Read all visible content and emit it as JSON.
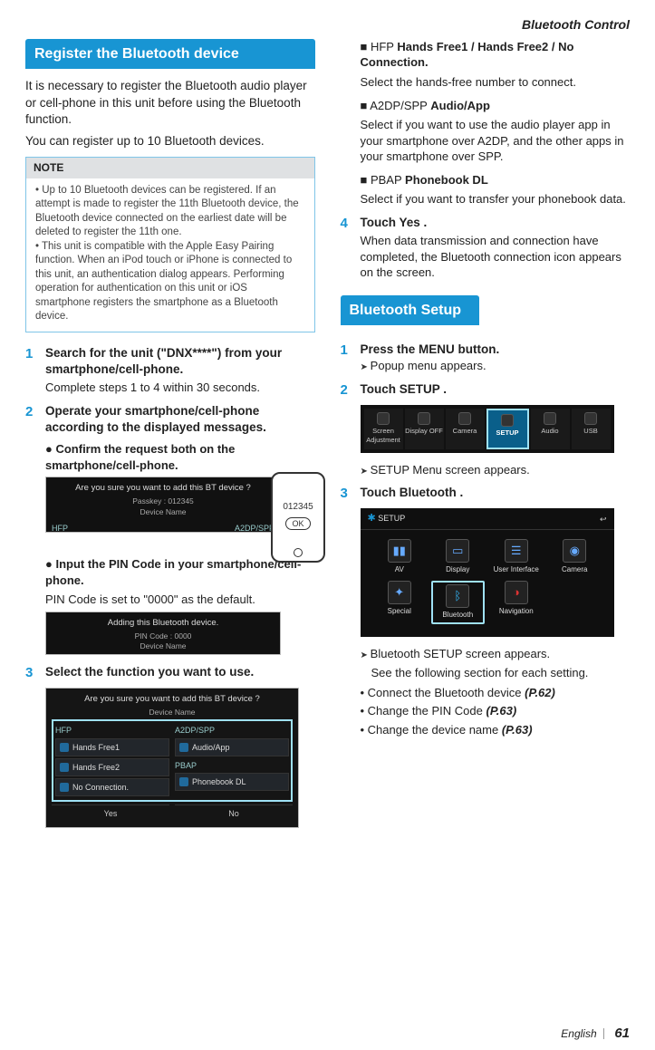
{
  "header": {
    "title": "Bluetooth Control"
  },
  "footer": {
    "lang": "English",
    "page": "61"
  },
  "left": {
    "sectionBar": "Register the Bluetooth device",
    "intro1": "It is necessary to register the Bluetooth audio player or cell-phone in this unit before using the Bluetooth function.",
    "intro2": "You can register up to 10 Bluetooth devices.",
    "noteLabel": "NOTE",
    "note1": "Up to 10 Bluetooth devices can be registered. If an attempt is made to register the 11th Bluetooth device, the Bluetooth device connected on the earliest date will be deleted to register the 11th one.",
    "note2": "This unit is compatible with the Apple Easy Pairing function. When an iPod touch or iPhone is connected to this unit, an authentication dialog appears. Performing operation for authentication on this unit or iOS smartphone registers the smartphone as a Bluetooth device.",
    "step1Title": "Search for the unit (\"DNX****\") from your smartphone/cell-phone.",
    "step1Desc": "Complete steps 1 to 4 within 30 seconds.",
    "step2Title": "Operate your smartphone/cell-phone according to the displayed messages.",
    "step2aTitle": "Confirm the request both on the smartphone/cell-phone.",
    "img1": {
      "line1": "Are you sure you want to add this BT device ?",
      "line2": "Passkey : 012345",
      "line3": "Device Name",
      "hfp": "HFP",
      "a2dp": "A2DP/SPP",
      "phoneCode": "012345",
      "phoneOk": "OK"
    },
    "step2bTitle": "Input the PIN Code in your smartphone/cell-phone.",
    "step2bDesc": "PIN Code is set to \"0000\" as the default.",
    "img2": {
      "line1": "Adding this Bluetooth device.",
      "line2": "PIN Code : 0000",
      "line3": "Device Name"
    },
    "step3Title": "Select the function you want to use.",
    "func": {
      "top": "Are you sure you want to add this BT device ?",
      "sub": "Device Name",
      "hfp": "HFP",
      "a2dp": "A2DP/SPP",
      "pbap": "PBAP",
      "hf1": "Hands Free1",
      "hf2": "Hands Free2",
      "noconn": "No Connection.",
      "audioapp": "Audio/App",
      "phonebook": "Phonebook DL",
      "yes": "Yes",
      "no": "No"
    }
  },
  "right": {
    "hfpLabel": "HFP",
    "hfpOpts": "Hands Free1 /  Hands Free2 /  No Connection.",
    "hfpDesc": "Select the hands-free number to connect.",
    "a2dpLabel": "A2DP/SPP",
    "a2dpOpt": "Audio/App",
    "a2dpDesc": "Select if you want to use the audio player app in your smartphone over A2DP, and the other apps in your smartphone over SPP.",
    "pbapLabel": "PBAP",
    "pbapOpt": "Phonebook DL",
    "pbapDesc": "Select if you want to transfer your phonebook data.",
    "step4Pre": "Touch ",
    "step4Opt": "Yes",
    "step4Post": " .",
    "step4Desc": "When data transmission and connection have completed, the Bluetooth connection icon appears on the screen.",
    "sectionBar": "Bluetooth Setup",
    "bs1Pre": "Press the ",
    "bs1Opt": "MENU",
    "bs1Post": " button.",
    "bs1Res": "Popup menu appears.",
    "bs2Pre": "Touch ",
    "bs2Opt": "SETUP",
    "bs2Post": " .",
    "menu": {
      "i1": "Screen Adjustment",
      "i2": "Display OFF",
      "i3": "Camera",
      "i4": "SETUP",
      "i5": "Audio",
      "i6": "USB"
    },
    "bs2Res": "SETUP Menu screen appears.",
    "bs3Pre": "Touch ",
    "bs3Opt": "Bluetooth",
    "bs3Post": " .",
    "setup": {
      "title": "SETUP",
      "t1": "AV",
      "t2": "Display",
      "t3": "User Interface",
      "t4": "Camera",
      "t5": "Special",
      "t6": "Bluetooth",
      "t7": "Navigation"
    },
    "bs3Res": "Bluetooth SETUP screen appears.",
    "bs3Res2": "See the following section for each setting.",
    "link1Pre": "Connect the Bluetooth device ",
    "link1Ref": "(P.62)",
    "link2Pre": "Change the PIN Code ",
    "link2Ref": "(P.63)",
    "link3Pre": "Change the device name ",
    "link3Ref": "(P.63)"
  }
}
